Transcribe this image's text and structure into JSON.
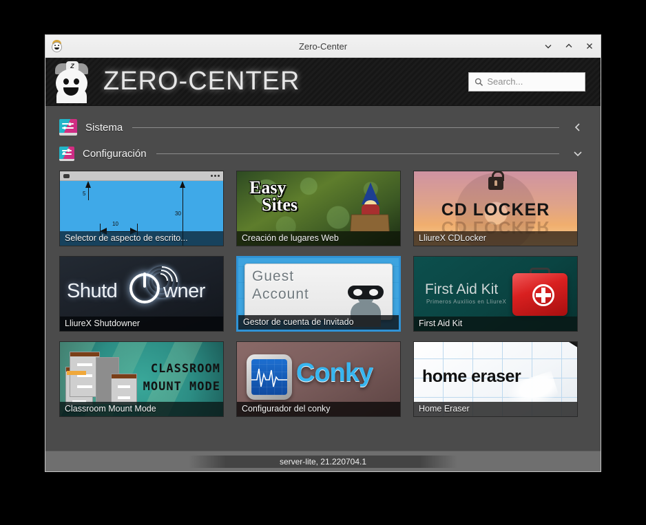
{
  "window": {
    "title": "Zero-Center",
    "icon_name": "zero-center-mascot-icon",
    "controls": {
      "minimize": "minimize",
      "maximize": "maximize",
      "close": "close"
    }
  },
  "banner": {
    "logo_text": "ZERO-CENTER",
    "mascot_cap_letter": "Z"
  },
  "search": {
    "placeholder": "Search...",
    "value": ""
  },
  "sections": [
    {
      "id": "sistema",
      "title": "Sistema",
      "expanded": false,
      "chevron": "chevron-left"
    },
    {
      "id": "configuracion",
      "title": "Configuración",
      "expanded": true,
      "chevron": "chevron-down"
    }
  ],
  "apps": [
    {
      "caption": "Selector de aspecto de escrito...",
      "art_title": "",
      "labels": {
        "a": "5",
        "b": "30",
        "c": "10"
      },
      "selected": false
    },
    {
      "caption": "Creación de lugares Web",
      "art_title_line1": "Easy",
      "art_title_line2": "Sites",
      "selected": false
    },
    {
      "caption": "LliureX CDLocker",
      "art_title": "CD LOCKER",
      "selected": false
    },
    {
      "caption": "LliureX Shutdowner",
      "art_title_a": "Shutd",
      "art_title_b": "wner",
      "selected": false
    },
    {
      "caption": "Gestor de cuenta de Invitado",
      "art_title_line1": "Guest",
      "art_title_line2": "Account",
      "selected": true
    },
    {
      "caption": "First Aid Kit",
      "art_title": "First Aid Kit",
      "art_subtitle": "Primeros Auxilios en LliureX",
      "selected": false
    },
    {
      "caption": "Classroom Mount Mode",
      "art_title_line1": "CLASSROOM",
      "art_title_line2": "MOUNT MODE",
      "selected": false
    },
    {
      "caption": "Configurador del conky",
      "art_title": "Conky",
      "selected": false
    },
    {
      "caption": "Home Eraser",
      "art_title": "home eraser",
      "selected": false
    }
  ],
  "status": {
    "text": "server-lite, 21.220704.1"
  },
  "colors": {
    "accent": "#2f93d6",
    "content_bg": "#4b4b4b",
    "banner_bg": "#1a1a1a",
    "statusbar_bg": "#6f6f6f"
  }
}
